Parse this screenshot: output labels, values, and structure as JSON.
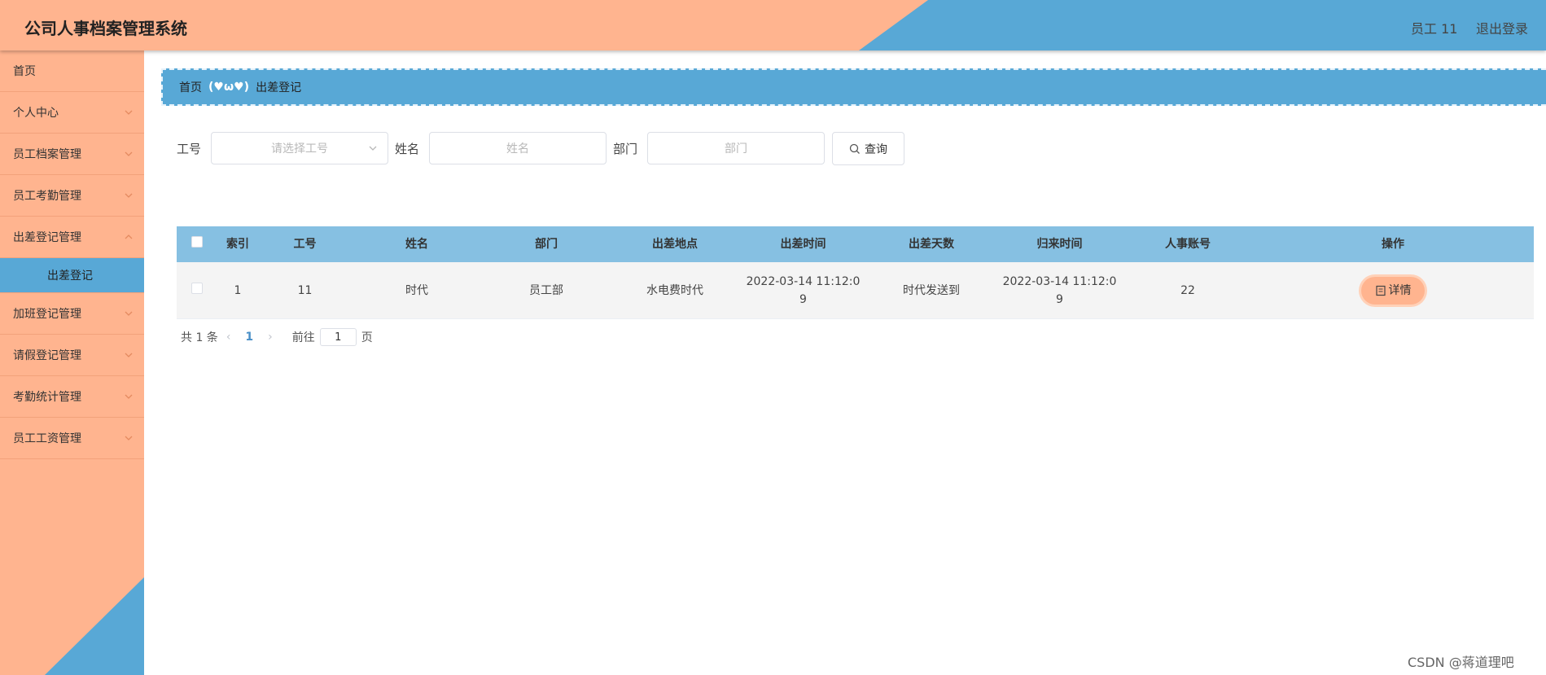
{
  "header": {
    "title": "公司人事档案管理系统",
    "user": "员工 11",
    "logout": "退出登录"
  },
  "sidebar": {
    "items": [
      {
        "label": "首页",
        "has_arrow": false
      },
      {
        "label": "个人中心",
        "has_arrow": true
      },
      {
        "label": "员工档案管理",
        "has_arrow": true
      },
      {
        "label": "员工考勤管理",
        "has_arrow": true
      },
      {
        "label": "出差登记管理",
        "has_arrow": true,
        "expanded": true
      },
      {
        "label": "加班登记管理",
        "has_arrow": true
      },
      {
        "label": "请假登记管理",
        "has_arrow": true
      },
      {
        "label": "考勤统计管理",
        "has_arrow": true
      },
      {
        "label": "员工工资管理",
        "has_arrow": true
      }
    ],
    "active_sub": "出差登记"
  },
  "breadcrumb": {
    "home": "首页",
    "separator": "(♥ω♥)",
    "current": "出差登记"
  },
  "filters": {
    "employee_id_label": "工号",
    "employee_id_placeholder": "请选择工号",
    "name_label": "姓名",
    "name_placeholder": "姓名",
    "department_label": "部门",
    "department_placeholder": "部门",
    "query_button": "查询"
  },
  "table": {
    "columns": [
      "索引",
      "工号",
      "姓名",
      "部门",
      "出差地点",
      "出差时间",
      "出差天数",
      "归来时间",
      "人事账号",
      "操作"
    ],
    "rows": [
      {
        "index": "1",
        "employee_id": "11",
        "name": "时代",
        "department": "员工部",
        "location": "水电费时代",
        "trip_time_line1": "2022-03-14 11:12:0",
        "trip_time_line2": "9",
        "days": "时代发送到",
        "return_time_line1": "2022-03-14 11:12:0",
        "return_time_line2": "9",
        "hr_account": "22",
        "action": "详情"
      }
    ]
  },
  "pagination": {
    "total": "共 1 条",
    "current_page": "1",
    "goto_label": "前往",
    "goto_value": "1",
    "page_suffix": "页"
  },
  "watermark": "CSDN @蒋道理吧",
  "colors": {
    "peach": "#ffb48f",
    "blue": "#58a8d6",
    "table_header": "#86c0e2"
  }
}
